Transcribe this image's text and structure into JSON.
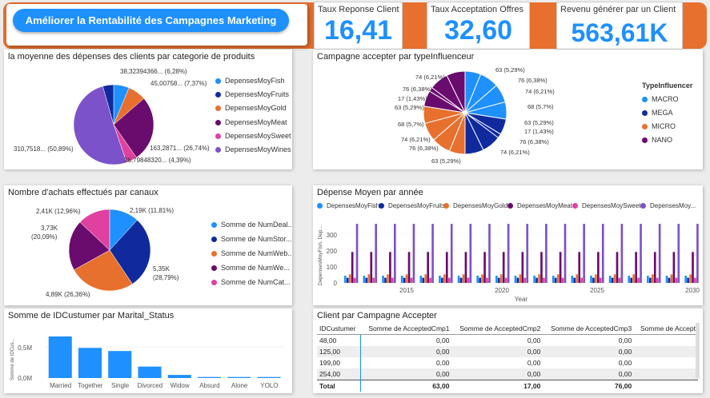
{
  "header": {
    "title": "Améliorer la Rentabilité des Campagnes Marketing",
    "colors": {
      "orange": "#e8702e",
      "accent": "#1e90ff"
    }
  },
  "kpis": [
    {
      "label": "Taux Reponse Client",
      "value": "16,41"
    },
    {
      "label": "Taux Acceptation Offres",
      "value": "32,60"
    },
    {
      "label": "Revenu générer par un Client",
      "value": "563,61K"
    }
  ],
  "pie_depenses": {
    "title": "la moyenne des dépenses des clients par categorie de produits",
    "legend": [
      "DepensesMoyFish",
      "DepensesMoyFruits",
      "DepensesMoyGold",
      "DepensesMoyMeat",
      "DepensesMoySweet",
      "DepensesMoyWines"
    ],
    "labels": [
      "38,32394366... (6,28%)",
      "45,00758... (7,37%)",
      "163,2871... (26,74%)",
      "26,79848320... (4,39%)",
      "310,7518... (50,89%)"
    ]
  },
  "donut_influenceur": {
    "title": "Campagne accepter par typeInfluenceur",
    "legend_title": "TypeInfluencer",
    "legend": [
      "MACRO",
      "MEGA",
      "MICRO",
      "NANO"
    ],
    "labels": [
      "63 (5,29%)",
      "76 (6,38%)",
      "74 (6,21%)",
      "68 (5,7%)",
      "63 (5,29%)",
      "17 (1,43%)",
      "76 (6,38%)",
      "74 (6,21%)",
      "63 (5,29%)",
      "76 (6,38%)",
      "74 (6,21%)",
      "68 (5,7%)",
      "63 (5,29%)",
      "17 (1,43%)",
      "76 (6,38%)",
      "74 (6,21%)"
    ]
  },
  "pie_achats": {
    "title": "Nombre d'achats effectués par canaux",
    "legend": [
      "Somme de NumDeal...",
      "Somme de NumStor...",
      "Somme de NumWeb...",
      "Somme de  NumWe...",
      "Somme de  NumCat..."
    ],
    "labels": [
      "2,19K (11,81%)",
      "5,35K",
      "(28,79%)",
      "4,89K (26,36%)",
      "3,73K",
      "(20,09%)",
      "2,41K (12,96%)"
    ]
  },
  "bar_annee": {
    "title": "Dépense Moyen par année",
    "legend": [
      "DepensesMoyFish",
      "DepensesMoyFruits",
      "DepensesMoyGold",
      "DepensesMoyMeat",
      "DepensesMoySweet",
      "DepensesMoy..."
    ],
    "ylabel": "DepensesMoyFish, Dep...",
    "xlabel": "Year",
    "yticks": [
      "300",
      "200",
      "100",
      "0"
    ],
    "xticks": [
      "2015",
      "2020",
      "2025",
      "2030"
    ]
  },
  "bar_marital": {
    "title": "Somme de IDCustumer par Marital_Status",
    "ylabel": "Somme de IDCus...",
    "yticks": [
      "0,5M",
      "0,0M"
    ]
  },
  "table": {
    "title": "Client par Campagne Accepter",
    "headers": [
      "IDCustumer",
      "Somme de AcceptedCmp1",
      "Somme de AcceptedCmp2",
      "Somme de AcceptedCmp3",
      "Somme de Accept"
    ],
    "rows": [
      [
        "48,00",
        "0,00",
        "0,00",
        "0,00",
        ""
      ],
      [
        "125,00",
        "0,00",
        "0,00",
        "0,00",
        ""
      ],
      [
        "199,00",
        "0,00",
        "0,00",
        "0,00",
        ""
      ],
      [
        "254,00",
        "0,00",
        "0,00",
        "0,00",
        ""
      ]
    ],
    "total": [
      "Total",
      "63,00",
      "17,00",
      "76,00",
      ""
    ]
  },
  "chart_data": [
    {
      "type": "pie",
      "title": "la moyenne des dépenses des clients par categorie de produits",
      "categories": [
        "DepensesMoyFish",
        "DepensesMoyFruits",
        "DepensesMoyGold",
        "DepensesMoyMeat",
        "DepensesMoySweet",
        "DepensesMoyWines"
      ],
      "values": [
        38.32,
        26.8,
        45.01,
        163.29,
        26.8,
        310.75
      ],
      "percents": [
        6.28,
        4.39,
        7.37,
        26.74,
        4.39,
        50.89
      ],
      "colors": [
        "#1e90ff",
        "#102a9e",
        "#e8702e",
        "#6a0b6e",
        "#e040a0",
        "#7b52c9"
      ]
    },
    {
      "type": "pie",
      "title": "Campagne accepter par typeInfluenceur",
      "categories": [
        "MACRO",
        "MEGA",
        "MICRO",
        "NANO"
      ],
      "values": [
        63,
        76,
        74,
        68,
        63,
        17,
        76,
        74,
        63,
        76,
        74,
        68,
        63,
        17,
        76,
        74
      ],
      "series_index": [
        0,
        0,
        0,
        0,
        1,
        1,
        1,
        1,
        2,
        2,
        2,
        2,
        3,
        3,
        3,
        3
      ],
      "colors": [
        "#1e90ff",
        "#102a9e",
        "#e8702e",
        "#6a0b6e"
      ]
    },
    {
      "type": "pie",
      "title": "Nombre d'achats effectués par canaux",
      "categories": [
        "Somme de NumDeal...",
        "Somme de NumStor...",
        "Somme de NumWeb...",
        "Somme de  NumWe...",
        "Somme de  NumCat..."
      ],
      "values": [
        2190,
        5350,
        4890,
        3730,
        2410
      ],
      "percents": [
        11.81,
        28.79,
        26.36,
        20.09,
        12.96
      ],
      "colors": [
        "#1e90ff",
        "#102a9e",
        "#e8702e",
        "#6a0b6e",
        "#e040a0"
      ]
    },
    {
      "type": "bar",
      "title": "Dépense Moyen par année",
      "xlabel": "Year",
      "x_range": [
        2012,
        2030
      ],
      "categories": [
        2012,
        2013,
        2014,
        2015,
        2016,
        2017,
        2018,
        2019,
        2020,
        2021,
        2022,
        2023,
        2024,
        2025,
        2026,
        2027,
        2028,
        2029,
        2030
      ],
      "ylim": [
        0,
        320
      ],
      "series": [
        {
          "name": "DepensesMoyFish",
          "values": [
            38,
            38,
            38,
            38,
            38,
            38,
            38,
            38,
            38,
            38,
            38,
            38,
            38,
            38,
            38,
            38,
            38,
            38,
            38
          ],
          "color": "#1e90ff"
        },
        {
          "name": "DepensesMoyFruits",
          "values": [
            27,
            27,
            27,
            27,
            27,
            27,
            27,
            27,
            27,
            27,
            27,
            27,
            27,
            27,
            27,
            27,
            27,
            27,
            27
          ],
          "color": "#102a9e"
        },
        {
          "name": "DepensesMoyGold",
          "values": [
            45,
            45,
            45,
            45,
            45,
            45,
            45,
            45,
            45,
            45,
            45,
            45,
            45,
            45,
            45,
            45,
            45,
            45,
            45
          ],
          "color": "#e8702e"
        },
        {
          "name": "DepensesMoyMeat",
          "values": [
            163,
            163,
            163,
            163,
            163,
            163,
            163,
            163,
            163,
            163,
            163,
            163,
            163,
            163,
            163,
            163,
            163,
            163,
            163
          ],
          "color": "#6a0b6e"
        },
        {
          "name": "DepensesMoySweet",
          "values": [
            27,
            27,
            27,
            27,
            27,
            27,
            27,
            27,
            27,
            27,
            27,
            27,
            27,
            27,
            27,
            27,
            27,
            27,
            27
          ],
          "color": "#e040a0"
        },
        {
          "name": "DepensesMoy...",
          "values": [
            311,
            311,
            311,
            311,
            311,
            311,
            311,
            311,
            311,
            311,
            311,
            311,
            311,
            311,
            311,
            311,
            311,
            311,
            311
          ],
          "color": "#7b52c9"
        }
      ]
    },
    {
      "type": "bar",
      "title": "Somme de IDCustumer par Marital_Status",
      "categories": [
        "Married",
        "Together",
        "Single",
        "Divorced",
        "Widow",
        "Absurd",
        "Alone",
        "YOLO"
      ],
      "values": [
        0.8,
        0.58,
        0.52,
        0.22,
        0.06,
        0.02,
        0.02,
        0.02
      ],
      "ylim": [
        0,
        1.0
      ],
      "color": "#1e90ff"
    }
  ]
}
